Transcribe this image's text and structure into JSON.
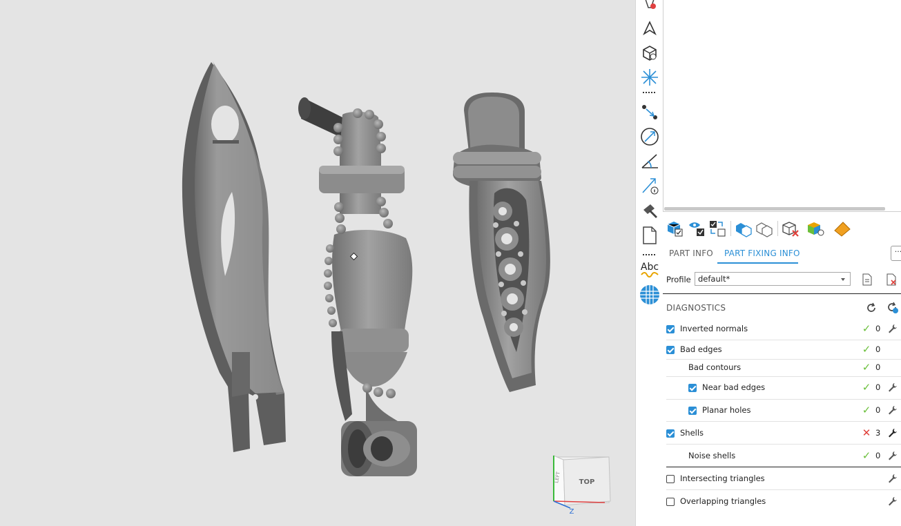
{
  "right_panel": {
    "tabs": [
      {
        "label": "PART INFO",
        "active": false
      },
      {
        "label": "PART FIXING INFO",
        "active": true
      }
    ],
    "more_label": "···",
    "profile": {
      "label": "Profile",
      "value": "default*"
    },
    "diagnostics": {
      "title": "DIAGNOSTICS",
      "rows": [
        {
          "label": "Inverted normals",
          "checkbox": "checked",
          "status": "ok",
          "count": "0",
          "fix": true
        },
        {
          "label": "Bad edges",
          "checkbox": "checked",
          "status": "ok",
          "count": "0",
          "fix": false
        },
        {
          "label": "Bad contours",
          "checkbox": "none",
          "status": "ok",
          "count": "0",
          "fix": false
        },
        {
          "label": "Near bad edges",
          "checkbox": "checked",
          "status": "ok",
          "count": "0",
          "fix": true
        },
        {
          "label": "Planar holes",
          "checkbox": "checked",
          "status": "ok",
          "count": "0",
          "fix": true
        },
        {
          "label": "Shells",
          "checkbox": "checked",
          "status": "error",
          "count": "3",
          "fix": true
        },
        {
          "label": "Noise shells",
          "checkbox": "none",
          "status": "ok",
          "count": "0",
          "fix": true
        },
        {
          "label": "Intersecting triangles",
          "checkbox": "unchecked",
          "status": "none",
          "count": "",
          "fix": true
        },
        {
          "label": "Overlapping triangles",
          "checkbox": "unchecked",
          "status": "none",
          "count": "",
          "fix": true
        }
      ]
    }
  },
  "viewcube": {
    "face_label": "TOP",
    "side_label": "LEFT",
    "axis_label": "Z"
  },
  "toolbar_text": {
    "abc_label": "Abc"
  },
  "colors": {
    "accent": "#2b8fd6",
    "ok": "#6abf3a",
    "error": "#e0403a",
    "viewport_bg": "#e4e4e4"
  }
}
